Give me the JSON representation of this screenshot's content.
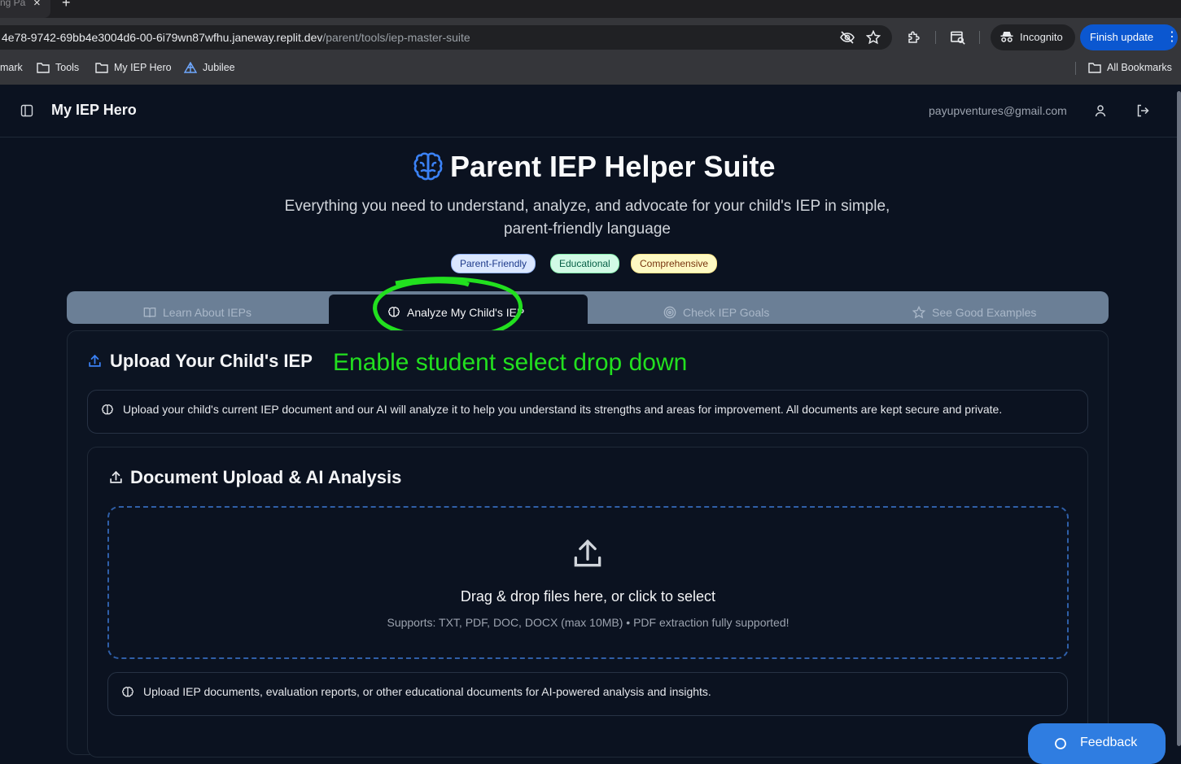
{
  "browser": {
    "tab_title": "ng Pa",
    "tab_close": "×",
    "new_tab": "+",
    "url_host": "4e78-9742-69bb4e3004d6-00-6i79wn87wfhu.janeway.replit.dev",
    "url_path": "/parent/tools/iep-master-suite",
    "incognito_label": "Incognito",
    "finish_update_label": "Finish update",
    "bookmarks": [
      "mark",
      "Tools",
      "My IEP Hero",
      "Jubilee"
    ],
    "all_bookmarks": "All Bookmarks"
  },
  "app": {
    "title": "My IEP Hero",
    "user_email": "payupventures@gmail.com"
  },
  "hero": {
    "title": "Parent IEP Helper Suite",
    "subtitle": "Everything you need to understand, analyze, and advocate for your child's IEP in simple, parent-friendly language",
    "badges": [
      {
        "label": "Parent-Friendly",
        "bg": "#dbe7ff",
        "fg": "#1e3a8a",
        "border": "#93b4f5"
      },
      {
        "label": "Educational",
        "bg": "#d1fae5",
        "fg": "#065f46",
        "border": "#86efac"
      },
      {
        "label": "Comprehensive",
        "bg": "#fef9c3",
        "fg": "#78350f",
        "border": "#fde68a"
      }
    ]
  },
  "tabs": [
    {
      "label": "Learn About IEPs",
      "icon": "book-icon",
      "active": false
    },
    {
      "label": "Analyze My Child's IEP",
      "icon": "brain-icon",
      "active": true
    },
    {
      "label": "Check IEP Goals",
      "icon": "target-icon",
      "active": false
    },
    {
      "label": "See Good Examples",
      "icon": "star-icon",
      "active": false
    }
  ],
  "upload_section": {
    "title": "Upload Your Child's IEP",
    "info": "Upload your child's current IEP document and our AI will analyze it to help you understand its strengths and areas for improvement. All documents are kept secure and private."
  },
  "analysis_card": {
    "title": "Document Upload & AI Analysis",
    "drop_title": "Drag & drop files here, or click to select",
    "drop_support": "Supports: TXT, PDF, DOC, DOCX (max 10MB) • PDF extraction fully supported!",
    "note": "Upload IEP documents, evaluation reports, or other educational documents for AI-powered analysis and insights."
  },
  "annotation": {
    "text": "Enable student select drop down",
    "color": "#22e01f"
  },
  "feedback": {
    "label": "Feedback"
  },
  "colors": {
    "accent": "#3b82f6",
    "background": "#0b1220"
  }
}
